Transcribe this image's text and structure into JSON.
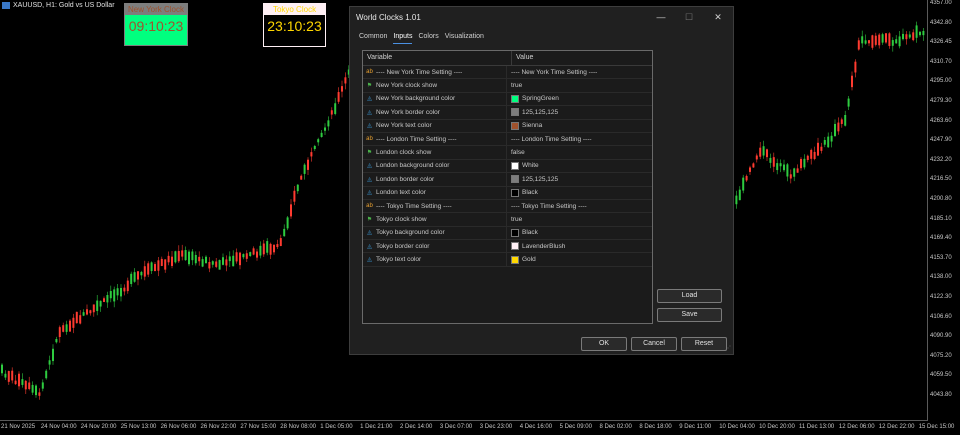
{
  "chart": {
    "symbol": "XAUUSD, H1:  Gold vs US Dollar",
    "price_labels": [
      "4357.00",
      "4342.80",
      "4326.45",
      "4310.70",
      "4295.00",
      "4279.30",
      "4263.60",
      "4247.90",
      "4232.20",
      "4216.50",
      "4200.80",
      "4185.10",
      "4169.40",
      "4153.70",
      "4138.00",
      "4122.30",
      "4106.60",
      "4090.90",
      "4075.20",
      "4059.50",
      "4043.80"
    ],
    "time_labels": [
      "21 Nov 2025",
      "24 Nov 04:00",
      "24 Nov 20:00",
      "25 Nov 13:00",
      "26 Nov 06:00",
      "26 Nov 22:00",
      "27 Nov 15:00",
      "28 Nov 08:00",
      "1 Dec 05:00",
      "1 Dec 21:00",
      "2 Dec 14:00",
      "3 Dec 07:00",
      "3 Dec 23:00",
      "4 Dec 16:00",
      "5 Dec 09:00",
      "8 Dec 02:00",
      "8 Dec 18:00",
      "9 Dec 11:00",
      "10 Dec 04:00",
      "10 Dec 20:00",
      "11 Dec 13:00",
      "12 Dec 06:00",
      "12 Dec 22:00",
      "15 Dec 15:00"
    ],
    "bull_color": "#2ecc40",
    "bear_color": "#ff3b30"
  },
  "ny_clock": {
    "title": "New York Clock",
    "time": "09:10:23",
    "bg": "#00ff7f",
    "border": "#7d7d7d",
    "text": "#a0522d"
  },
  "tokyo_clock": {
    "title": "Tokyo Clock",
    "time": "23:10:23",
    "bg": "#000000",
    "border": "#fff0f5",
    "text": "#ffd700"
  },
  "dialog": {
    "title": "World Clocks 1.01",
    "minimize": "—",
    "maximize": "☐",
    "close": "✕",
    "tabs": [
      "Common",
      "Inputs",
      "Colors",
      "Visualization"
    ],
    "active_tab": "Inputs",
    "columns": {
      "variable": "Variable",
      "value": "Value"
    },
    "rows": [
      {
        "icon": "ab",
        "type": "sep",
        "variable": "---- New York Time Setting ----",
        "value": "---- New York Time Setting ----"
      },
      {
        "icon": "⚑",
        "type": "flag",
        "variable": "New York clock show",
        "value": "true"
      },
      {
        "icon": "◬",
        "type": "attr",
        "variable": "New York background color",
        "value": "SpringGreen",
        "swatch": "#00ff7f"
      },
      {
        "icon": "◬",
        "type": "attr",
        "variable": "New York border color",
        "value": "125,125,125",
        "swatch": "#7d7d7d"
      },
      {
        "icon": "◬",
        "type": "attr",
        "variable": "New York text color",
        "value": "Sienna",
        "swatch": "#a0522d"
      },
      {
        "icon": "ab",
        "type": "sep",
        "variable": "---- London Time Setting ----",
        "value": "---- London Time Setting ----"
      },
      {
        "icon": "⚑",
        "type": "flag",
        "variable": "London clock show",
        "value": "false"
      },
      {
        "icon": "◬",
        "type": "attr",
        "variable": "London background color",
        "value": "White",
        "swatch": "#ffffff"
      },
      {
        "icon": "◬",
        "type": "attr",
        "variable": "London border color",
        "value": "125,125,125",
        "swatch": "#7d7d7d"
      },
      {
        "icon": "◬",
        "type": "attr",
        "variable": "London text color",
        "value": "Black",
        "swatch": "#000000"
      },
      {
        "icon": "ab",
        "type": "sep",
        "variable": "---- Tokyo Time Setting ----",
        "value": "---- Tokyo Time Setting ----"
      },
      {
        "icon": "⚑",
        "type": "flag",
        "variable": "Tokyo clock show",
        "value": "true"
      },
      {
        "icon": "◬",
        "type": "attr",
        "variable": "Tokyo background color",
        "value": "Black",
        "swatch": "#000000"
      },
      {
        "icon": "◬",
        "type": "attr",
        "variable": "Tokyo border color",
        "value": "LavenderBlush",
        "swatch": "#fff0f5"
      },
      {
        "icon": "◬",
        "type": "attr",
        "variable": "Tokyo text color",
        "value": "Gold",
        "swatch": "#ffd700"
      }
    ],
    "buttons": {
      "load": "Load",
      "save": "Save",
      "ok": "OK",
      "cancel": "Cancel",
      "reset": "Reset"
    },
    "grip": "⋰"
  }
}
